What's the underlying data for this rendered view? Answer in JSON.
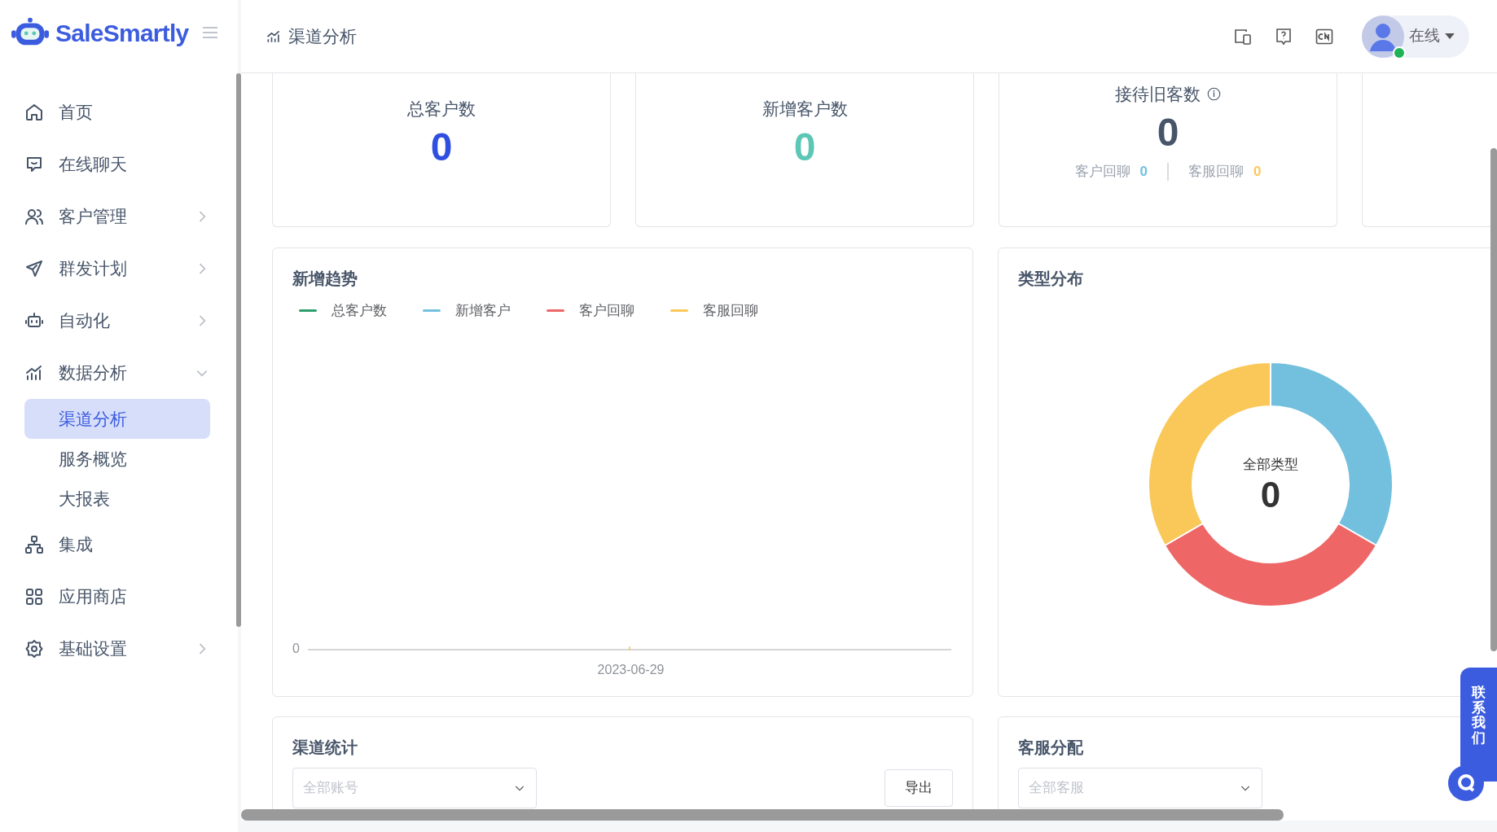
{
  "sidebar": {
    "logo": "SaleSmartly",
    "items": [
      {
        "label": "首页",
        "kind": "link",
        "selected": false
      },
      {
        "label": "在线聊天",
        "kind": "link",
        "selected": false
      },
      {
        "label": "客户管理",
        "kind": "group",
        "expanded": false,
        "selected": false
      },
      {
        "label": "群发计划",
        "kind": "group",
        "expanded": false,
        "selected": false
      },
      {
        "label": "自动化",
        "kind": "group",
        "expanded": false,
        "selected": false
      },
      {
        "label": "数据分析",
        "kind": "group",
        "expanded": true,
        "selected": false,
        "children": [
          {
            "label": "渠道分析",
            "selected": true
          },
          {
            "label": "服务概览",
            "selected": false
          },
          {
            "label": "大报表",
            "selected": false
          }
        ]
      },
      {
        "label": "集成",
        "kind": "link",
        "selected": false
      },
      {
        "label": "应用商店",
        "kind": "link",
        "selected": false
      },
      {
        "label": "基础设置",
        "kind": "group",
        "expanded": false,
        "selected": false
      }
    ]
  },
  "header": {
    "title": "渠道分析",
    "user": {
      "status": "在线",
      "online": true
    }
  },
  "stat_cards": [
    {
      "title": "总客户数",
      "value": "0",
      "color": "#2f4fe0"
    },
    {
      "title": "新增客户数",
      "value": "0",
      "color": "#5cc7b5"
    },
    {
      "title": "接待旧客数",
      "info": true,
      "value": "0",
      "color": "#475569",
      "breakdown": [
        {
          "label": "客户回聊",
          "value": "0",
          "color": "#73c0de"
        },
        {
          "label": "客服回聊",
          "value": "0",
          "color": "#fac858"
        }
      ]
    }
  ],
  "trend_panel": {
    "title": "新增趋势",
    "y_label": "0",
    "x_label": "2023-06-29",
    "legend": [
      {
        "name": "总客户数",
        "color": "#2e9e6e"
      },
      {
        "name": "新增客户",
        "color": "#73c0de"
      },
      {
        "name": "客户回聊",
        "color": "#ee6666"
      },
      {
        "name": "客服回聊",
        "color": "#fac858"
      }
    ]
  },
  "type_panel": {
    "title": "类型分布",
    "center_label": "全部类型",
    "center_value": "0"
  },
  "channel_panel": {
    "title": "渠道统计",
    "account_select": {
      "placeholder": "全部账号"
    },
    "export_button": "导出"
  },
  "agent_panel": {
    "title": "客服分配",
    "agent_select": {
      "placeholder": "全部客服"
    }
  },
  "contact_button": "联系我们"
}
